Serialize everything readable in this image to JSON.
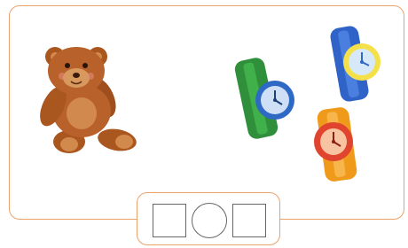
{
  "scene": {
    "items": [
      {
        "kind": "teddy-bear",
        "icon": "teddy-bear-icon",
        "color": "#b8612a"
      },
      {
        "kind": "watch",
        "icon": "watch-icon",
        "strap_color": "#2f8f3a",
        "face_color": "#2d69c5"
      },
      {
        "kind": "watch",
        "icon": "watch-icon",
        "strap_color": "#2f63c8",
        "face_color": "#f4e14a"
      },
      {
        "kind": "watch",
        "icon": "watch-icon",
        "strap_color": "#f09a1c",
        "face_color": "#e0442f"
      }
    ]
  },
  "answer": {
    "slots": [
      {
        "shape": "square",
        "value": ""
      },
      {
        "shape": "circle",
        "value": ""
      },
      {
        "shape": "square",
        "value": ""
      }
    ]
  }
}
